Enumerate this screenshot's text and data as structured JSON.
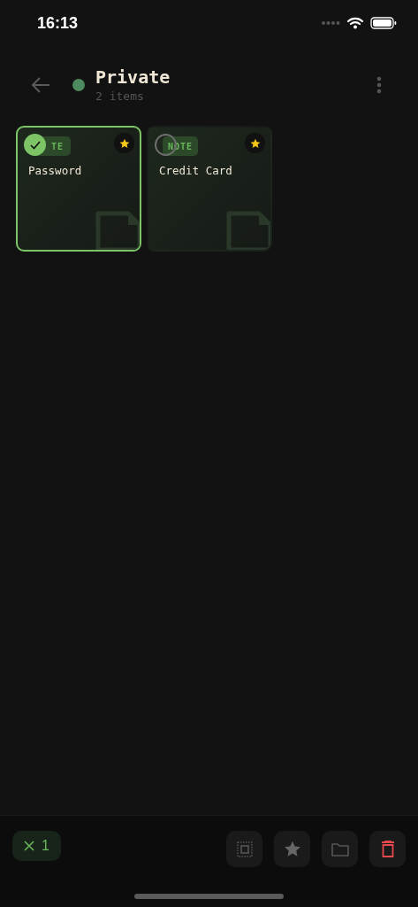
{
  "status_bar": {
    "time": "16:13"
  },
  "header": {
    "title": "Private",
    "subtitle": "2 items",
    "color": "#4e8a5f"
  },
  "cards": [
    {
      "title": "Password",
      "badge": "TE",
      "selected": true,
      "starred": true
    },
    {
      "title": "Credit Card",
      "badge": "NOTE",
      "selected": false,
      "starred": true
    }
  ],
  "selection_bar": {
    "count": "1"
  }
}
